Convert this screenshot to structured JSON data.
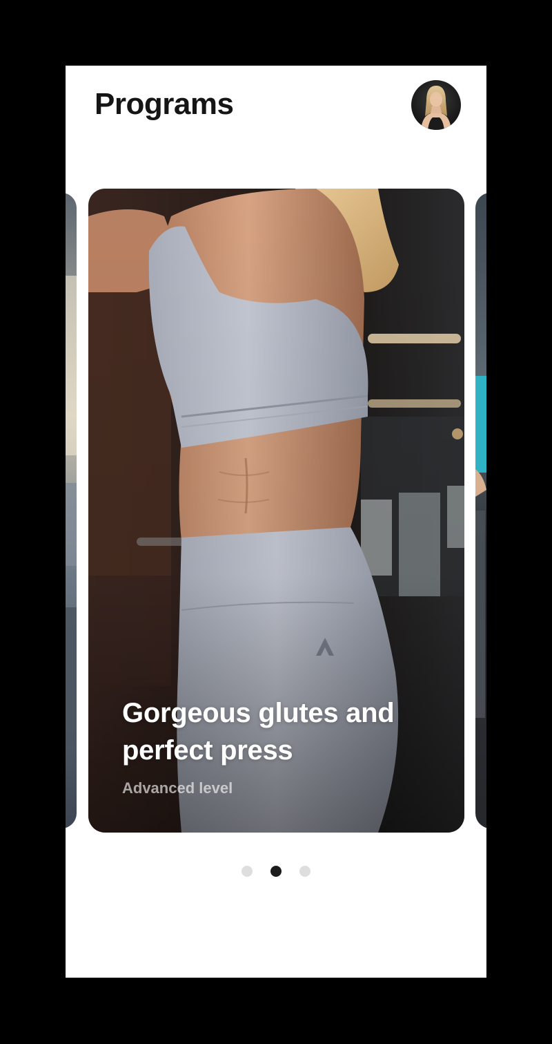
{
  "header": {
    "title": "Programs",
    "avatar_icon": "user-avatar"
  },
  "carousel": {
    "cards": [
      {
        "title": "Gorgeous glutes and perfect press",
        "subtitle": "Advanced level"
      }
    ],
    "pager": {
      "count": 3,
      "active_index": 1
    }
  },
  "colors": {
    "background": "#ffffff",
    "outer_frame": "#000000",
    "title_text": "#151515",
    "dot_active": "#1c1c1c",
    "dot_inactive": "#dedede"
  }
}
